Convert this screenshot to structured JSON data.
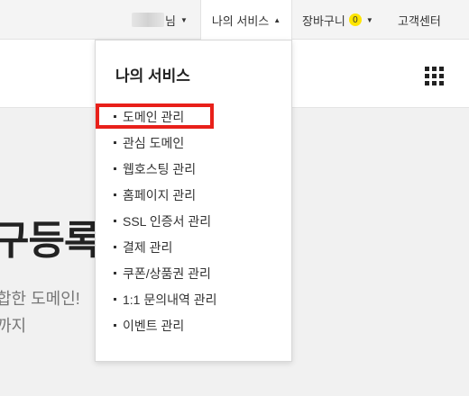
{
  "topbar": {
    "user_suffix": "님",
    "my_service": "나의 서비스",
    "cart": "장바구니",
    "cart_count": "0",
    "support": "고객센터"
  },
  "dropdown": {
    "title": "나의 서비스",
    "items": [
      "도메인 관리",
      "관심 도메인",
      "웹호스팅 관리",
      "홈페이지 관리",
      "SSL 인증서 관리",
      "결제 관리",
      "쿠폰/상품권 관리",
      "1:1 문의내역 관리",
      "이벤트 관리"
    ]
  },
  "hero": {
    "title_fragment": "구등록",
    "sub_line1": "합한 도메인!",
    "sub_line2": "까지"
  },
  "colors": {
    "highlight": "#e8201a",
    "badge": "#ffe500"
  },
  "icons": {
    "apps": "grid-apps-icon"
  }
}
